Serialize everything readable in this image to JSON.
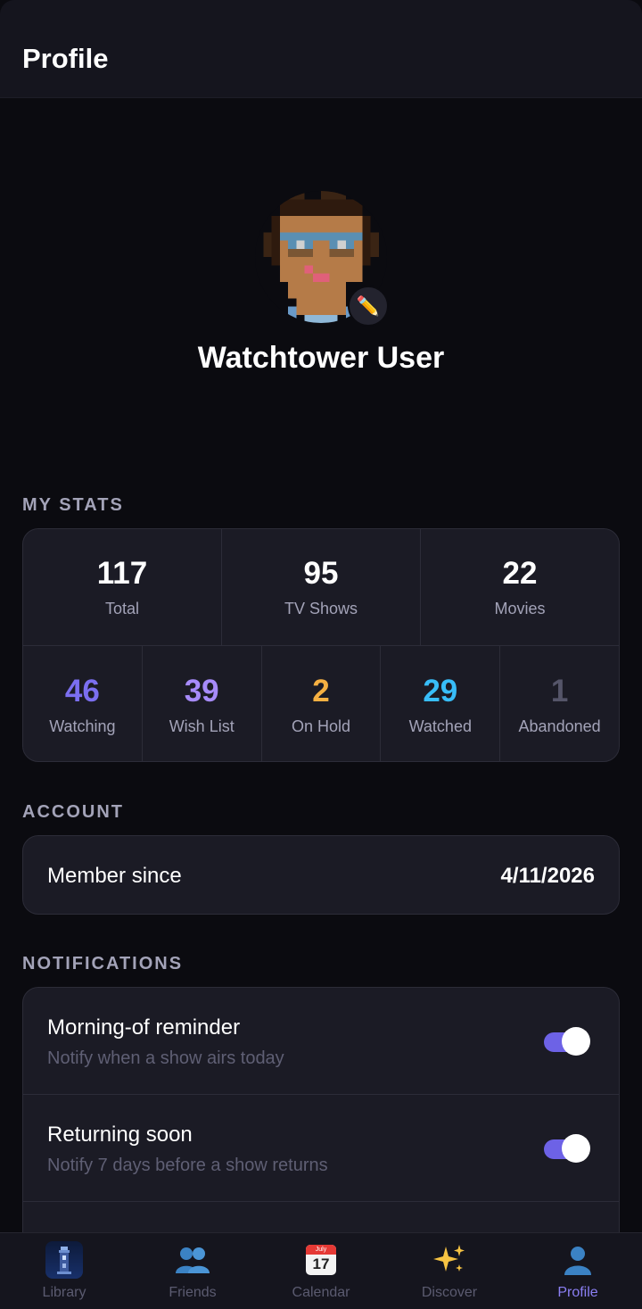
{
  "header": {
    "title": "Profile"
  },
  "profile": {
    "name": "Watchtower User",
    "edit_icon": "pencil-icon"
  },
  "stats": {
    "section_title": "MY STATS",
    "top": [
      {
        "value": "117",
        "label": "Total",
        "color": "#ffffff"
      },
      {
        "value": "95",
        "label": "TV Shows",
        "color": "#ffffff"
      },
      {
        "value": "22",
        "label": "Movies",
        "color": "#ffffff"
      }
    ],
    "bottom": [
      {
        "value": "46",
        "label": "Watching",
        "color": "#7b6ff0"
      },
      {
        "value": "39",
        "label": "Wish List",
        "color": "#a78bfa"
      },
      {
        "value": "2",
        "label": "On Hold",
        "color": "#f5b042"
      },
      {
        "value": "29",
        "label": "Watched",
        "color": "#38bdf8"
      },
      {
        "value": "1",
        "label": "Abandoned",
        "color": "#555569"
      }
    ]
  },
  "account": {
    "section_title": "ACCOUNT",
    "member_since_label": "Member since",
    "member_since_value": "4/11/2026"
  },
  "notifications": {
    "section_title": "NOTIFICATIONS",
    "items": [
      {
        "title": "Morning-of reminder",
        "subtitle": "Notify when a show airs today",
        "enabled": true
      },
      {
        "title": "Returning soon",
        "subtitle": "Notify 7 days before a show returns",
        "enabled": true
      }
    ],
    "accent": "#6d62e6"
  },
  "nav": {
    "items": [
      {
        "label": "Library",
        "icon": "tower-icon",
        "active": false
      },
      {
        "label": "Friends",
        "icon": "people-icon",
        "active": false
      },
      {
        "label": "Calendar",
        "icon": "calendar-icon",
        "active": false,
        "month": "July",
        "day": "17"
      },
      {
        "label": "Discover",
        "icon": "sparkles-icon",
        "active": false
      },
      {
        "label": "Profile",
        "icon": "person-icon",
        "active": true
      }
    ],
    "active_color": "#8b7ff3"
  }
}
